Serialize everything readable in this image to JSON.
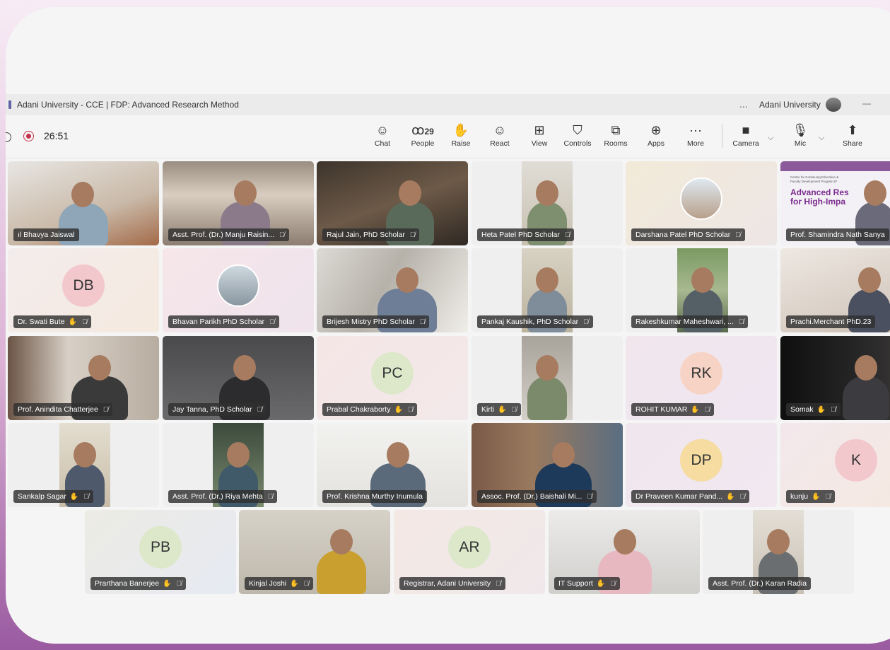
{
  "window": {
    "title": "Adani University - CCE | FDP: Advanced Research Method",
    "more": "...",
    "org": "Adani University",
    "minimize": "—"
  },
  "meeting": {
    "timer": "26:51"
  },
  "toolbar": {
    "chat": {
      "icon": "☺",
      "label": "Chat"
    },
    "people": {
      "icon": "ꝏ",
      "count": "29",
      "label": "People"
    },
    "raise": {
      "icon": "✋",
      "label": "Raise"
    },
    "react": {
      "icon": "☺",
      "label": "React"
    },
    "view": {
      "icon": "⊞",
      "label": "View"
    },
    "controls": {
      "icon": "⛉",
      "label": "Controls"
    },
    "rooms": {
      "icon": "⧉",
      "label": "Rooms"
    },
    "apps": {
      "icon": "⊕",
      "label": "Apps"
    },
    "more": {
      "icon": "···",
      "label": "More"
    },
    "camera": {
      "icon": "■",
      "label": "Camera"
    },
    "mic": {
      "icon": "🎙",
      "label": "Mic"
    },
    "share": {
      "icon": "⬆",
      "label": "Share"
    },
    "chevron": "⌵"
  },
  "tile_icons": {
    "mic_off": "🎙̸",
    "hand": "✋"
  },
  "participants": [
    {
      "name": "Bhavya Jaiswal",
      "prefix": "ıl"
    },
    {
      "name": "Asst. Prof. (Dr.) Manju Raisin..."
    },
    {
      "name": "Rajul Jain, PhD Scholar"
    },
    {
      "name": "Heta Patel PhD Scholar"
    },
    {
      "name": "Darshana Patel PhD Scholar"
    },
    {
      "name": "Prof. Shamindra Nath Sanya"
    },
    {
      "name": "Dr. Swati Bute",
      "initials": "DB"
    },
    {
      "name": "Bhavan Parikh PhD Scholar"
    },
    {
      "name": "Brijesh Mistry PhD Scholar"
    },
    {
      "name": "Pankaj Kaushik, PhD Scholar"
    },
    {
      "name": "Rakeshkumar Maheshwari, ..."
    },
    {
      "name": "Prachi.Merchant PhD.23"
    },
    {
      "name": "Prof. Anindita Chatterjee"
    },
    {
      "name": "Jay Tanna, PhD Scholar"
    },
    {
      "name": "Prabal Chakraborty",
      "initials": "PC"
    },
    {
      "name": "Kirti"
    },
    {
      "name": "ROHIT KUMAR",
      "initials": "RK"
    },
    {
      "name": "Somak"
    },
    {
      "name": "Sankalp Sagar"
    },
    {
      "name": "Asst. Prof. (Dr.) Riya Mehta"
    },
    {
      "name": "Prof. Krishna Murthy Inumula"
    },
    {
      "name": "Assoc. Prof. (Dr.) Baishali Mi..."
    },
    {
      "name": "Dr Praveen Kumar Pand...",
      "initials": "DP"
    },
    {
      "name": "kunju",
      "initials": "K"
    },
    {
      "name": "Prarthana Banerjee",
      "initials": "PB"
    },
    {
      "name": "Kinjal Joshi"
    },
    {
      "name": "Registrar, Adani University",
      "initials": "AR"
    },
    {
      "name": "IT Support"
    },
    {
      "name": "Asst. Prof. (Dr.) Karan Radia"
    }
  ],
  "slide": {
    "line1": "Centre for Continuing Education &",
    "line2": "Faculty Development Program (F",
    "title1": "Advanced Res",
    "title2": "for High-Impa"
  },
  "colors": {
    "avatar_pink": "#f2c8cc",
    "avatar_green": "#dde8cb",
    "avatar_yellow": "#f6dca0",
    "avatar_peach": "#f6d3c5",
    "recording": "#c4314b",
    "slide_purple": "#7b2d8e"
  }
}
